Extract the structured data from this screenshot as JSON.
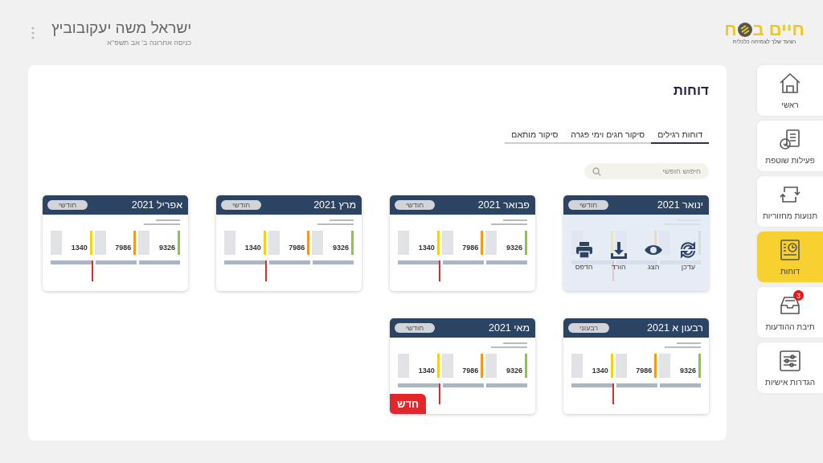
{
  "logo": {
    "title_start": "חיים ב",
    "title_end": "ח",
    "tagline": "הצעד שלך לצמיחה כלכלית"
  },
  "user": {
    "name": "ישראל משה יעקובוביץ",
    "last_login": "כניסה אחרונה ב' אב תשפ\"א"
  },
  "sidebar": {
    "items": [
      {
        "label": "ראשי",
        "selected": false
      },
      {
        "label": "פעילות שוטפת",
        "selected": false
      },
      {
        "label": "תנועות מחזוריות",
        "selected": false
      },
      {
        "label": "דוחות",
        "selected": true
      },
      {
        "label": "תיבת ההודעות",
        "selected": false,
        "badge": "3"
      },
      {
        "label": "הגדרות אישיות",
        "selected": false
      }
    ]
  },
  "page": {
    "title": "דוחות",
    "tabs": [
      {
        "label": "דוחות רגילים",
        "selected": true
      },
      {
        "label": "סיקור חגים וימי פגרה",
        "selected": false
      },
      {
        "label": "סיקור מותאם",
        "selected": false
      }
    ],
    "search": {
      "placeholder": "חיפוש חופשי"
    },
    "cards": [
      {
        "title": "ינואר 2021",
        "period": "חודשי",
        "actions_open": true
      },
      {
        "title": "פבואר 2021",
        "period": "חודשי",
        "actions_open": false,
        "income": "9326",
        "expenses": "7986",
        "balance": "1340"
      },
      {
        "title": "מרץ 2021",
        "period": "חודשי",
        "actions_open": false,
        "income": "9326",
        "expenses": "7986",
        "balance": "1340"
      },
      {
        "title": "אפריל 2021",
        "period": "חודשי",
        "actions_open": false,
        "income": "9326",
        "expenses": "7986",
        "balance": "1340"
      },
      {
        "title": "רבעון א 2021",
        "period": "רבעוני",
        "actions_open": false,
        "income": "9326",
        "expenses": "7986",
        "balance": "1340"
      },
      {
        "title": "מאי 2021",
        "period": "חודשי",
        "actions_open": false,
        "income": "9326",
        "expenses": "7986",
        "balance": "1340",
        "badge": "חדש"
      }
    ],
    "card_actions": [
      {
        "label": "עדכן"
      },
      {
        "label": "הצג"
      },
      {
        "label": "הורד"
      },
      {
        "label": "הדפס"
      }
    ]
  }
}
